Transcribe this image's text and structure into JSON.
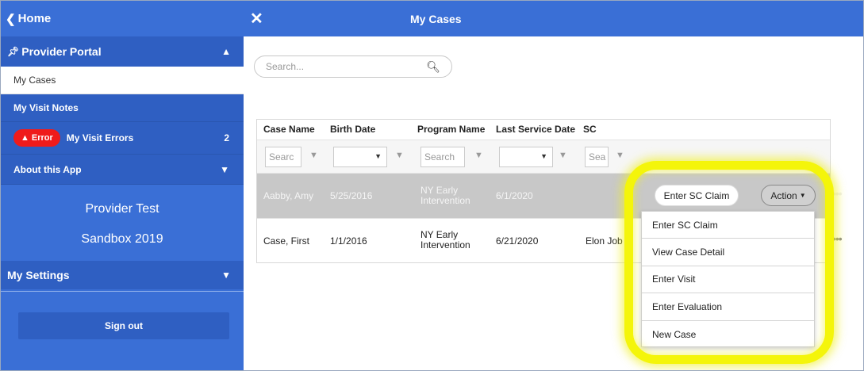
{
  "sidebar": {
    "home_label": "Home",
    "portal_label": "Provider Portal",
    "items": [
      {
        "label": "My Cases"
      },
      {
        "label": "My Visit Notes"
      },
      {
        "label": "My Visit Errors",
        "badge": "Error",
        "count": "2"
      },
      {
        "label": "About this App"
      }
    ],
    "provider_line1": "Provider Test",
    "provider_line2": "Sandbox 2019",
    "settings_label": "My Settings",
    "signout_label": "Sign out"
  },
  "topbar": {
    "title": "My Cases"
  },
  "search": {
    "placeholder": "Search..."
  },
  "grid": {
    "columns": [
      "Case Name",
      "Birth Date",
      "Program Name",
      "Last Service Date",
      "SC"
    ],
    "filter_placeholders": {
      "case_name": "Searc",
      "program_name": "Search",
      "sc": "Sea"
    },
    "rows": [
      {
        "case_name": "Aabby, Amy",
        "birth_date": "5/25/2016",
        "program_line1": "NY Early",
        "program_line2": "Intervention",
        "last_service": "6/1/2020",
        "sc": ""
      },
      {
        "case_name": "Case, First",
        "birth_date": "1/1/2016",
        "program_line1": "NY Early",
        "program_line2": "Intervention",
        "last_service": "6/21/2020",
        "sc": "Elon Job"
      }
    ],
    "enter_sc_claim_label": "Enter SC Claim",
    "action_label": "Action"
  },
  "menu": {
    "items": [
      "Enter SC Claim",
      "View Case Detail",
      "Enter Visit",
      "Enter Evaluation",
      "New Case"
    ]
  },
  "colors": {
    "primary": "#3a6fd6",
    "primary_dark": "#2f5fc2",
    "error": "#ef1b1b",
    "highlight": "#f4f50a"
  }
}
